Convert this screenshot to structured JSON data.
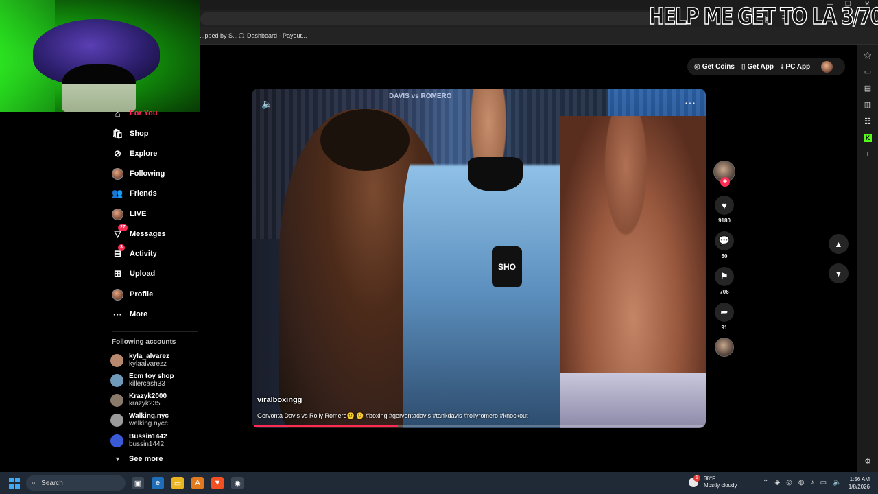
{
  "browser": {
    "bookmarks": [
      "...pped by S...",
      "Dashboard - Payout..."
    ],
    "stream_overlay_text": "HELP ME GET TO LA 3/70"
  },
  "header": {
    "get_coins": "Get Coins",
    "get_app": "Get App",
    "pc_app": "PC App"
  },
  "nav": {
    "items": [
      {
        "label": "For You",
        "icon": "home-icon",
        "active": true
      },
      {
        "label": "Shop",
        "icon": "shop-bag-icon"
      },
      {
        "label": "Explore",
        "icon": "compass-icon"
      },
      {
        "label": "Following",
        "icon": "avatar-icon"
      },
      {
        "label": "Friends",
        "icon": "friends-icon"
      },
      {
        "label": "LIVE",
        "icon": "live-avatar-icon"
      },
      {
        "label": "Messages",
        "icon": "paper-plane-icon",
        "badge": "27"
      },
      {
        "label": "Activity",
        "icon": "inbox-icon",
        "badge": "3"
      },
      {
        "label": "Upload",
        "icon": "plus-square-icon"
      },
      {
        "label": "Profile",
        "icon": "profile-avatar-icon"
      },
      {
        "label": "More",
        "icon": "ellipsis-icon"
      }
    ],
    "following_title": "Following accounts",
    "following": [
      {
        "name": "kyla_alvarez",
        "handle": "kylaalvarezz",
        "color": "#b9896f"
      },
      {
        "name": "Ecm toy shop",
        "handle": "killercash33",
        "color": "#6f9ab9"
      },
      {
        "name": "Krazyk2000",
        "handle": "krazyk235",
        "color": "#8a7a6a"
      },
      {
        "name": "Walking.nyc",
        "handle": "walking.nycc",
        "color": "#9a9a9a"
      },
      {
        "name": "Bussin1442",
        "handle": "bussin1442",
        "color": "#3b5bd6"
      }
    ],
    "see_more": "See more"
  },
  "video": {
    "banner": "DAVIS vs ROMERO",
    "mic_text": "SHO",
    "author": "viralboxingg",
    "caption": "Gervonta Davis vs Rolly Romero🙂 🙂 #boxing #gervontadavis #tankdavis #rollyromero #knockout",
    "progress": 0.32
  },
  "actions": {
    "likes": "9180",
    "comments": "50",
    "saves": "706",
    "shares": "91"
  },
  "taskbar": {
    "search": "Search",
    "weather_temp": "38°F",
    "weather_desc": "Mostly cloudy",
    "weather_badge": "1",
    "time": "1:56 AM",
    "date": "1/8/2026"
  },
  "colors": {
    "accent": "#fe2c55",
    "taskbar": "#1f2a36"
  }
}
